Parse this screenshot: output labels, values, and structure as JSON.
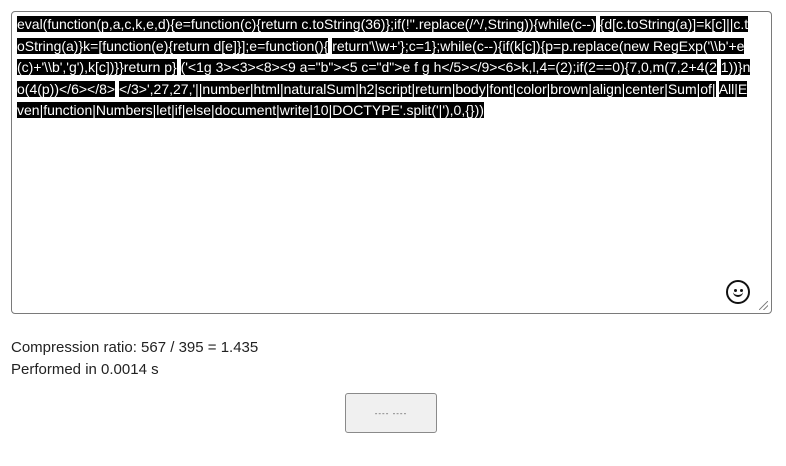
{
  "editor": {
    "code_lines": [
      "eval(function(p,a,c,k,e,d){e=function(c){return c.toString(36)};if(!''.replace(/^/,String)){while(c--)",
      "{d[c.toString(a)]=k[c]||c.toString(a)}k=[function(e){return d[e]}];e=function(){",
      "return'\\\\w+'};c=1};while(c--){if(k[c]){p=p.replace(new RegExp('\\\\b'+e(c)+'\\\\b','g'),k[c])}}return p}",
      "('<1g 3><3><8><9 a=\"b\"><5 c=\"d\">e f g h</5></9><6>k,l,4=(2);if(2==0){7,0,m(7,2+4(2",
      "1))}n o(4(p))</6></8>",
      "</3>',27,27,'||number|html|naturalSum|h2|script|return|body|font|color|brown|align|center|Sum|of|",
      "All|Even|function|Numbers|let|if|else|document|write|10|DOCTYPE'.split('|'),0,{}))"
    ],
    "emoji_icon": "smiley-icon"
  },
  "stats": {
    "compression_ratio": "Compression ratio: 567 / 395 = 1.435",
    "performed_in": "Performed in 0.0014 s"
  },
  "action_button": {
    "label": "---- ----"
  },
  "colors": {
    "selection_bg": "#000000",
    "selection_text": "#ffffff",
    "text": "#222222"
  }
}
